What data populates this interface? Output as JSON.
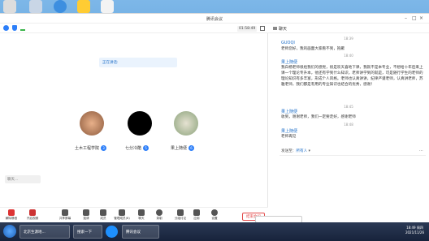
{
  "window": {
    "title": "腾讯会议",
    "timer": "01:58:49"
  },
  "video": {
    "speaking_label": "正在讲话:",
    "participants": [
      {
        "name": "土木工程学院",
        "badge": "3"
      },
      {
        "name": "七分冷酷",
        "badge": "5"
      },
      {
        "name": "果上随便",
        "badge": "6"
      }
    ],
    "chat_preview": "聊天..."
  },
  "toolbar": {
    "tools": [
      "解除静音",
      "开启视频",
      "共享屏幕",
      "邀请",
      "成员",
      "管理成员(6)",
      "聊天",
      "录制",
      "分组讨论",
      "应用",
      "设置"
    ],
    "end_label": "结束会议"
  },
  "chat": {
    "header": "聊天",
    "messages": [
      {
        "time": "18:39",
        "sender": "GUOQI",
        "text": "老师您好，我的画面大家看不到，抱歉"
      },
      {
        "time": "18:40",
        "sender": "果上随便",
        "text": "我白杨老师很给我们的感觉，很是欢天喜地下课，我就不是本专业，不想给十年后来上课一个理论专升本，他还有学到什么知识，老师讲学到的就是，可是随行学生的老师的理论知识有多丰富，形成个人风格。老师也认真讲讲，纪律严谨老师，认真讲老师，苏雅老师，我们都是有用的专业知识也结合的优秀，感谢！"
      },
      {
        "time": "18:45",
        "sender": "果上随便",
        "text": "收到，谢谢老师，我们一定要走好，感谢老师"
      },
      {
        "time": "18:48",
        "sender": "果上随便",
        "text": "老师再见"
      }
    ],
    "send_to_label": "发送至：",
    "send_to_value": "所有人"
  },
  "taskbar": {
    "items": [
      "北京生源地...",
      "搜索一下",
      "腾讯会议"
    ],
    "time": "18:49 周四",
    "date": "2021/11/26"
  }
}
